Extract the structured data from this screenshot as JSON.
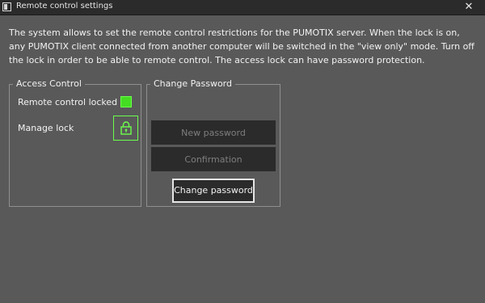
{
  "window": {
    "title": "Remote control settings",
    "close_glyph": "✕"
  },
  "description": "The system allows to set the remote control restrictions for the PUMOTIX server. When the lock is on, any PUMOTIX client connected from another computer will be switched in the \"view only\" mode. Turn off the lock in order to be able to remote control. The access lock can have password protection.",
  "access_control": {
    "title": "Access Control",
    "locked_label": "Remote control locked",
    "locked_state": true,
    "manage_label": "Manage lock",
    "lock_icon": "lock-icon"
  },
  "change_password": {
    "title": "Change Password",
    "new_password_placeholder": "New password",
    "confirmation_placeholder": "Confirmation",
    "button_label": "Change password"
  },
  "colors": {
    "window_bg": "#595959",
    "accent_green": "#44dd22",
    "field_bg": "#2b2b2b"
  }
}
